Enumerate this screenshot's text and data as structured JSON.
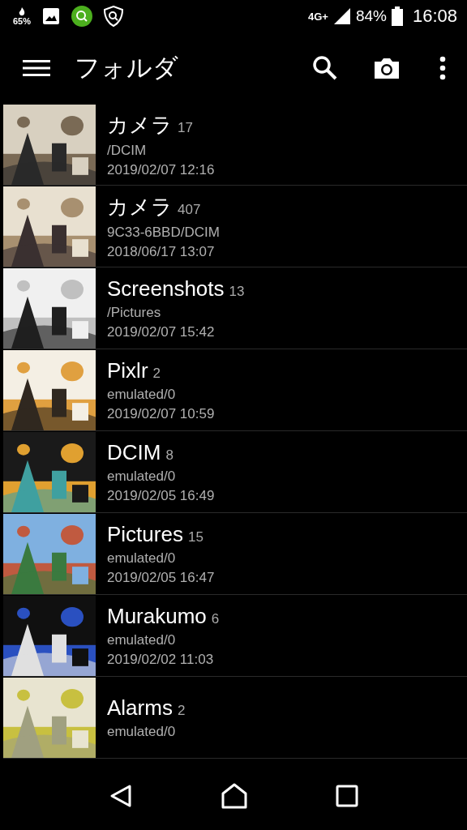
{
  "status_bar": {
    "heat_reading": "65%",
    "network": "4G+",
    "battery": "84%",
    "time": "16:08"
  },
  "app_bar": {
    "title": "フォルダ"
  },
  "folders": [
    {
      "name": "カメラ",
      "count": "17",
      "path": "/DCIM",
      "date": "2019/02/07 12:16"
    },
    {
      "name": "カメラ",
      "count": "407",
      "path": "9C33-6BBD/DCIM",
      "date": "2018/06/17 13:07"
    },
    {
      "name": "Screenshots",
      "count": "13",
      "path": "/Pictures",
      "date": "2019/02/07 15:42"
    },
    {
      "name": "Pixlr",
      "count": "2",
      "path": "emulated/0",
      "date": "2019/02/07 10:59"
    },
    {
      "name": "DCIM",
      "count": "8",
      "path": "emulated/0",
      "date": "2019/02/05 16:49"
    },
    {
      "name": "Pictures",
      "count": "15",
      "path": "emulated/0",
      "date": "2019/02/05 16:47"
    },
    {
      "name": "Murakumo",
      "count": "6",
      "path": "emulated/0",
      "date": "2019/02/02 11:03"
    },
    {
      "name": "Alarms",
      "count": "2",
      "path": "emulated/0"
    }
  ]
}
